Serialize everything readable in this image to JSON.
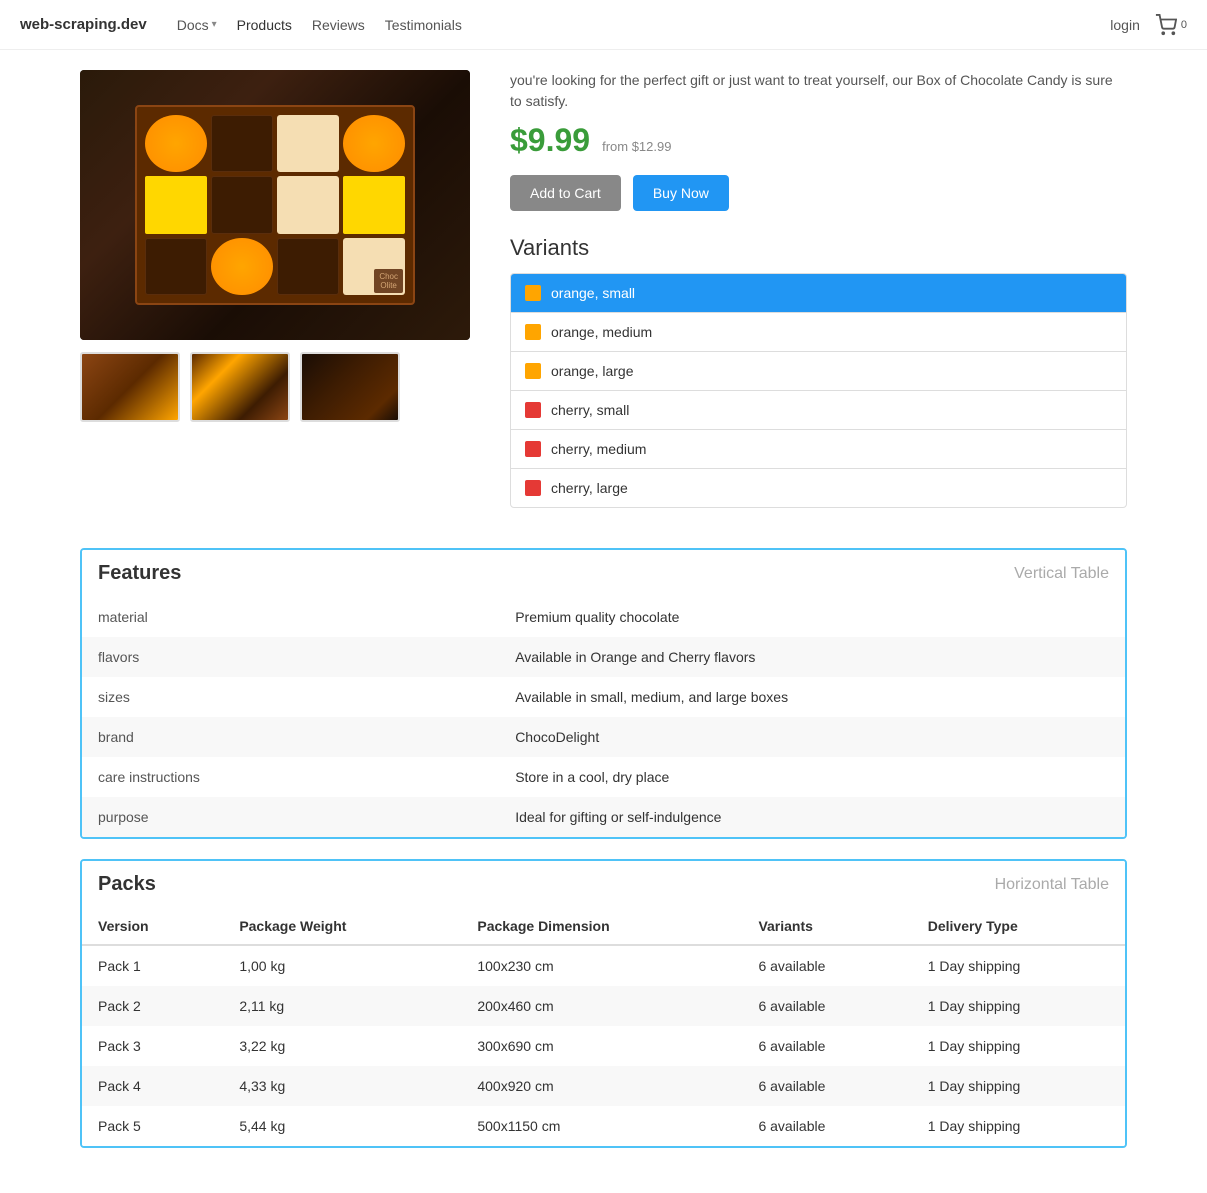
{
  "nav": {
    "brand": "web-scraping.dev",
    "links": [
      {
        "id": "docs",
        "label": "Docs",
        "hasDropdown": true
      },
      {
        "id": "products",
        "label": "Products",
        "active": true
      },
      {
        "id": "reviews",
        "label": "Reviews"
      },
      {
        "id": "testimonials",
        "label": "Testimonials"
      }
    ],
    "login": "login",
    "cart_count": "0"
  },
  "product": {
    "description": "you're looking for the perfect gift or just want to treat yourself, our Box of Chocolate Candy is sure to satisfy.",
    "price": "$9.99",
    "price_from": "from $12.99",
    "btn_add_cart": "Add to Cart",
    "btn_buy_now": "Buy Now"
  },
  "variants": {
    "title": "Variants",
    "items": [
      {
        "id": "orange-small",
        "label": "orange, small",
        "color": "#ffa500",
        "active": true
      },
      {
        "id": "orange-medium",
        "label": "orange, medium",
        "color": "#ffa500",
        "active": false
      },
      {
        "id": "orange-large",
        "label": "orange, large",
        "color": "#ffa500",
        "active": false
      },
      {
        "id": "cherry-small",
        "label": "cherry, small",
        "color": "#e53935",
        "active": false
      },
      {
        "id": "cherry-medium",
        "label": "cherry, medium",
        "color": "#e53935",
        "active": false
      },
      {
        "id": "cherry-large",
        "label": "cherry, large",
        "color": "#e53935",
        "active": false
      }
    ]
  },
  "features": {
    "title": "Features",
    "table_type": "Vertical Table",
    "rows": [
      {
        "key": "material",
        "value": "Premium quality chocolate"
      },
      {
        "key": "flavors",
        "value": "Available in Orange and Cherry flavors"
      },
      {
        "key": "sizes",
        "value": "Available in small, medium, and large boxes"
      },
      {
        "key": "brand",
        "value": "ChocoDelight"
      },
      {
        "key": "care instructions",
        "value": "Store in a cool, dry place"
      },
      {
        "key": "purpose",
        "value": "Ideal for gifting or self-indulgence"
      }
    ]
  },
  "packs": {
    "title": "Packs",
    "table_type": "Horizontal Table",
    "columns": [
      "Version",
      "Package Weight",
      "Package Dimension",
      "Variants",
      "Delivery Type"
    ],
    "rows": [
      {
        "version": "Pack 1",
        "weight": "1,00 kg",
        "dimension": "100x230 cm",
        "variants": "6 available",
        "delivery": "1 Day shipping"
      },
      {
        "version": "Pack 2",
        "weight": "2,11 kg",
        "dimension": "200x460 cm",
        "variants": "6 available",
        "delivery": "1 Day shipping"
      },
      {
        "version": "Pack 3",
        "weight": "3,22 kg",
        "dimension": "300x690 cm",
        "variants": "6 available",
        "delivery": "1 Day shipping"
      },
      {
        "version": "Pack 4",
        "weight": "4,33 kg",
        "dimension": "400x920 cm",
        "variants": "6 available",
        "delivery": "1 Day shipping"
      },
      {
        "version": "Pack 5",
        "weight": "5,44 kg",
        "dimension": "500x1150 cm",
        "variants": "6 available",
        "delivery": "1 Day shipping"
      }
    ]
  }
}
